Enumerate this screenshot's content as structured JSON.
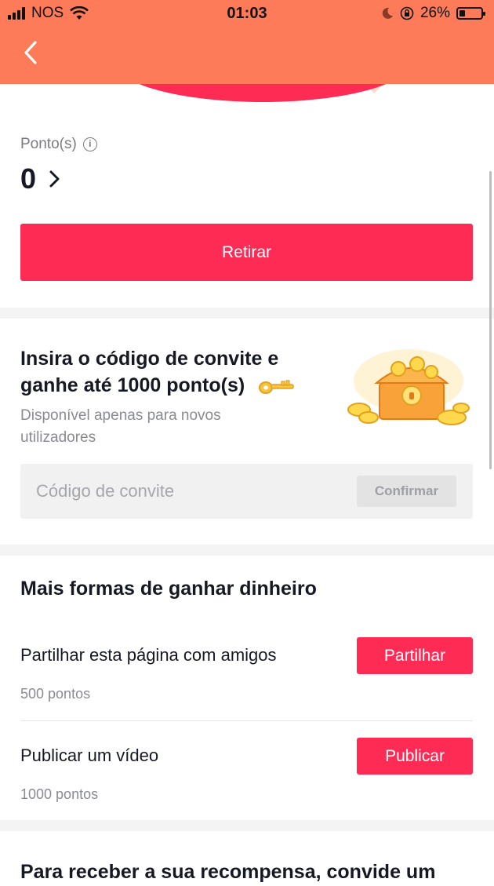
{
  "status_bar": {
    "carrier": "NOS",
    "time": "01:03",
    "battery": "26%",
    "battery_level": 0.26
  },
  "header": {
    "back_icon": "chevron-left-icon"
  },
  "points": {
    "label": "Ponto(s)",
    "value": "0",
    "withdraw_label": "Retirar"
  },
  "invite": {
    "title": "Insira o código de convite e ganhe até 1000 ponto(s)",
    "subtitle": "Disponível apenas para novos utilizadores",
    "placeholder": "Código de convite",
    "confirm_label": "Confirmar"
  },
  "earn": {
    "title": "Mais formas de ganhar dinheiro",
    "tasks": [
      {
        "name": "Partilhar esta página com amigos",
        "points": "500 pontos",
        "button": "Partilhar"
      },
      {
        "name": "Publicar um vídeo",
        "points": "1000 pontos",
        "button": "Publicar"
      }
    ]
  },
  "reward": {
    "title": "Para receber a sua recompensa, convide um"
  },
  "colors": {
    "header": "#fe7b59",
    "accent": "#fe2c55"
  }
}
